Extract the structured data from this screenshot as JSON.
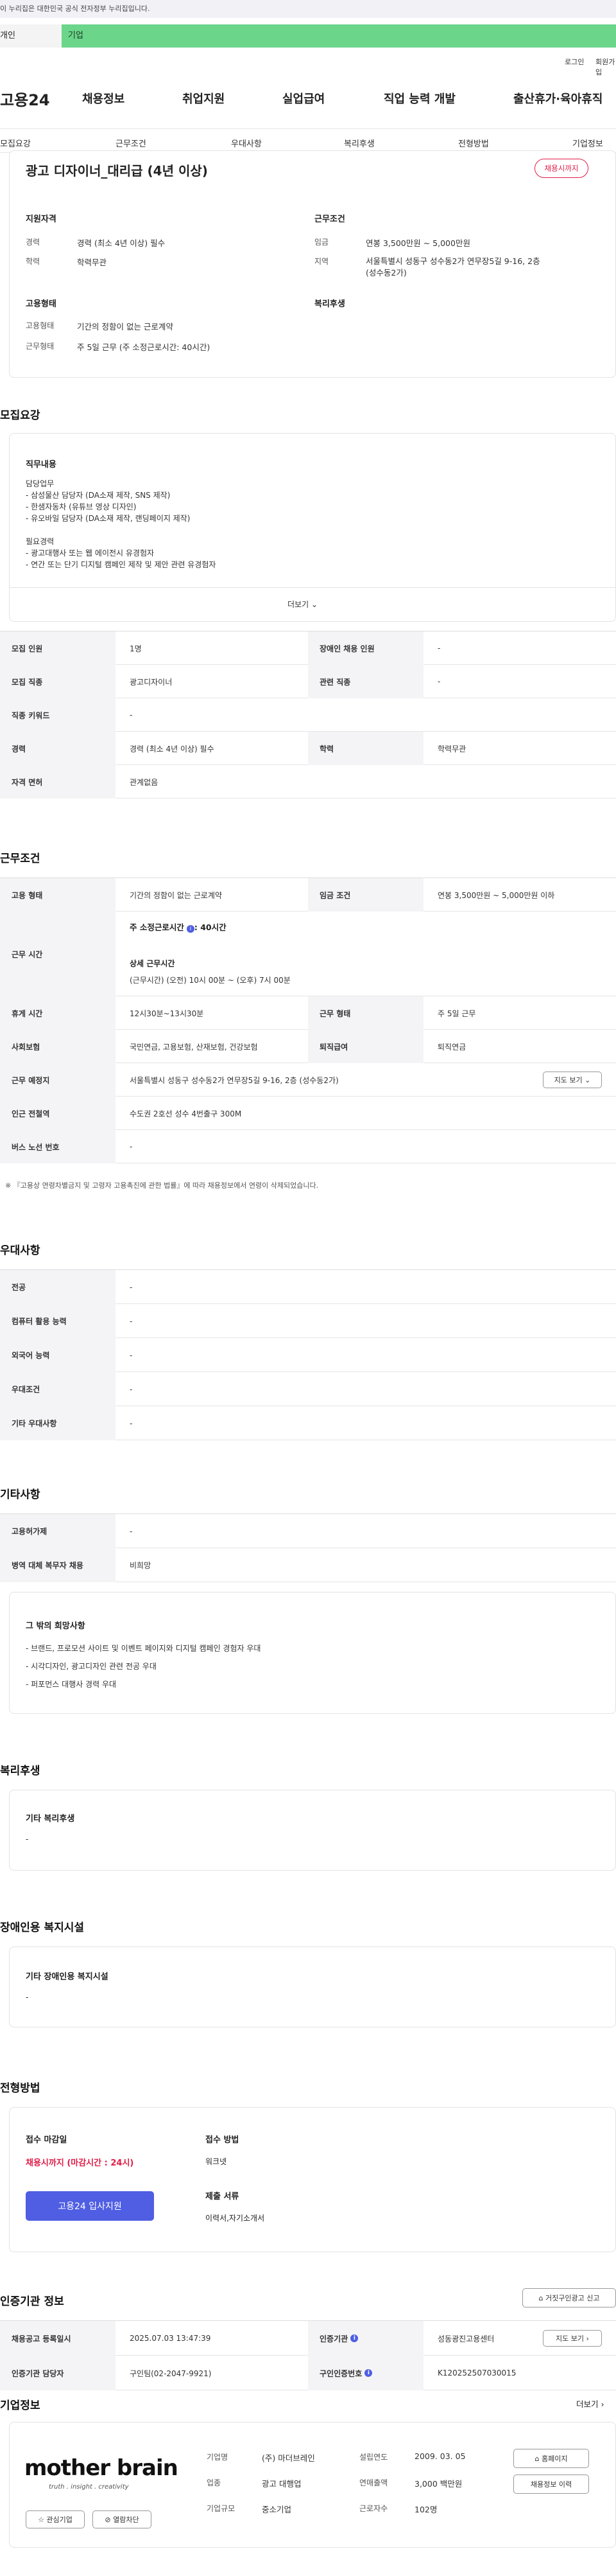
{
  "gov_banner": "이 누리집은 대한민국 공식 전자정부 누리집입니다.",
  "user_tabs": [
    "개인",
    "기업"
  ],
  "top_links": [
    "로그인",
    "회원가입"
  ],
  "logo": "고용24",
  "gnb": [
    "채용정보",
    "취업지원",
    "실업급여",
    "직업 능력 개발",
    "출산휴가·육아휴직"
  ],
  "subnav": [
    "모집요강",
    "근무조건",
    "우대사항",
    "복리후생",
    "전형방법",
    "기업정보"
  ],
  "summary": {
    "title": "광고 디자이너_대리급 (4년 이상)",
    "status_badge": "채용시까지",
    "support_heading": "지원자격",
    "career_label": "경력",
    "career_value": "경력 (최소 4년 이상) 필수",
    "edu_label": "학력",
    "edu_value": "학력무관",
    "work_heading": "근무조건",
    "wage_label": "임금",
    "wage_value": "연봉 3,500만원 ~ 5,000만원",
    "region_label": "지역",
    "region_value_1": "서울특별시 성동구 성수동2가 연무장5길 9-16, 2층",
    "region_value_2": "(성수동2가)",
    "emp_heading": "고용형태",
    "emp_label": "고용형태",
    "emp_value": "기간의 정함이 없는 근로계약",
    "hours_label": "근무형태",
    "hours_value": "주 5일 근무 (주 소정근로시간: 40시간)",
    "welfare_heading": "복리후생"
  },
  "recruit": {
    "heading": "모집요강",
    "duty_title": "직무내용",
    "duty_lines": [
      "담당업무",
      "- 삼성물산 담당자 (DA소재 제작, SNS 제작)",
      "- 한샘자동차 (유튜브 영상 디자인)",
      "- 유오바일 담당자 (DA소재 제작, 랜딩페이지 제작)",
      "",
      "필요경력",
      "- 광고대행사 또는 웹 에이전시 유경험자",
      "- 연간 또는 단기 디지털 캠페인 제작 및 제안 관련 유경험자"
    ],
    "more": "더보기",
    "rows": [
      [
        "모집 인원",
        "1명",
        "장애인 채용 인원",
        "-"
      ],
      [
        "모집 직종",
        "광고디자이너",
        "관련 직종",
        "-"
      ],
      [
        "직종 키워드",
        "-"
      ],
      [
        "경력",
        "경력 (최소 4년 이상) 필수",
        "학력",
        "학력무관"
      ],
      [
        "자격 면허",
        "관계없음"
      ]
    ]
  },
  "conditions": {
    "heading": "근무조건",
    "row1": [
      "고용 형태",
      "기간의 정함이 없는 근로계약",
      "임금 조건",
      "연봉 3,500만원 ~ 5,000만원 이하"
    ],
    "hours_label": "근무 시간",
    "hours_main": "주 소정근로시간",
    "hours_main_val": ": 40시간",
    "hours_detail_title": "상세 근무시간",
    "hours_detail": "(근무시간) (오전) 10시 00분 ~ (오후) 7시 00분",
    "row3": [
      "휴게 시간",
      "12시30분~13시30분",
      "근무 형태",
      "주 5일 근무"
    ],
    "row4": [
      "사회보험",
      "국민연금, 고용보험, 산재보험, 건강보험",
      "퇴직급여",
      "퇴직연금"
    ],
    "row5": [
      "근무 예정지",
      "서울특별시 성동구 성수동2가 연무장5길 9-16, 2층 (성수동2가)"
    ],
    "map_btn": "지도 보기",
    "row6": [
      "인근 전철역",
      "수도권 2호선 성수 4번출구 300M"
    ],
    "row7": [
      "버스 노선 번호",
      "-"
    ],
    "note": "※ 『고용상 연령차별금지 및 고령자 고용촉진에 관한 법률』에 따라 채용정보에서 연령이 삭제되었습니다."
  },
  "preference": {
    "heading": "우대사항",
    "rows": [
      [
        "전공",
        "-"
      ],
      [
        "컴퓨터 활용 능력",
        "-"
      ],
      [
        "외국어 능력",
        "-"
      ],
      [
        "우대조건",
        "-"
      ],
      [
        "기타 우대사항",
        "-"
      ]
    ]
  },
  "other": {
    "heading": "기타사항",
    "rows": [
      [
        "고용허가제",
        "-"
      ],
      [
        "병역 대체 복무자 채용",
        "비희망"
      ]
    ],
    "box_title": "그 밖의 희망사항",
    "box_lines": [
      "- 브랜드, 프로모션 사이트 및 이벤트 페이지와 디지털 캠페인 경험자 우대",
      "- 시각디자인, 광고디자인 관련 전공 우대",
      "- 퍼포먼스 대행사 경력 우대"
    ]
  },
  "welfare": {
    "heading": "복리후생",
    "box_title": "기타 복리후생",
    "box_value": "-"
  },
  "disability": {
    "heading": "장애인용 복지시설",
    "box_title": "기타 장애인용 복지시설",
    "box_value": "-"
  },
  "process": {
    "heading": "전형방법",
    "deadline_title": "접수 마감일",
    "deadline_value": "채용시까지 (마감시간 : 24시)",
    "apply_btn": "고용24 입사지원",
    "method_title": "접수 방법",
    "method_value": "워크넷",
    "docs_title": "제출 서류",
    "docs_value": "이력서,자기소개서"
  },
  "auth": {
    "heading": "인증기관 정보",
    "report_btn": "거짓구인광고 신고",
    "row1": [
      "채용공고 등록일시",
      "2025.07.03 13:47:39",
      "인증기관",
      "성동광진고용센터"
    ],
    "map_btn": "지도 보기",
    "row2": [
      "인증기관 담당자",
      "구인팀(02-2047-9921)",
      "구인인증번호",
      "K120252507030015"
    ]
  },
  "company": {
    "heading": "기업정보",
    "more": "더보기",
    "logo_main": "mother brain",
    "logo_sub": "truth . insight . creativity",
    "interest_btn": "관심기업",
    "view_btn": "열람차단",
    "name_label": "기업명",
    "name_value": "(주) 마더브레인",
    "industry_label": "업종",
    "industry_value": "광고 대행업",
    "size_label": "기업규모",
    "size_value": "중소기업",
    "founded_label": "설립연도",
    "founded_value": "2009. 03. 05",
    "sales_label": "연매출액",
    "sales_value": "3,000 백만원",
    "staff_label": "근로자수",
    "staff_value": "102명",
    "homepage_btn": "홈페이지",
    "jobs_btn": "채용정보 이력"
  }
}
